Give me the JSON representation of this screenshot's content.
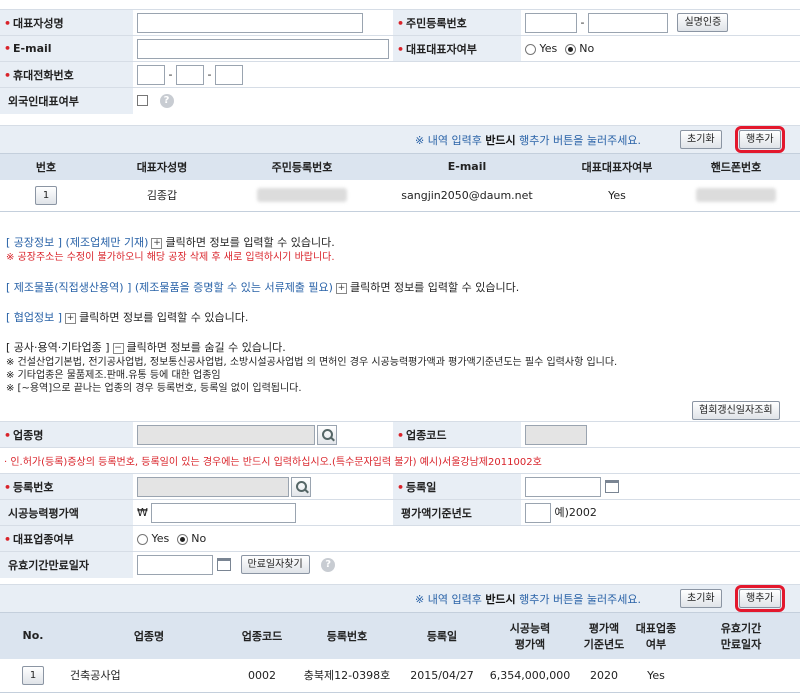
{
  "rep": {
    "name_label": "대표자성명",
    "rrn_label": "주민등록번호",
    "verify_btn": "실명인증",
    "email_label": "E-mail",
    "is_rep_label": "대표대표자여부",
    "yes": "Yes",
    "no": "No",
    "phone_label": "휴대전화번호",
    "foreign_label": "외국인대표여부",
    "notice_pre": "※ 내역 입력후 ",
    "notice_bold": "반드시",
    "notice_post": " 행추가 버튼을 눌러주세요.",
    "reset_btn": "초기화",
    "add_btn": "행추가",
    "dash": "-"
  },
  "rep_table": {
    "headers": [
      "번호",
      "대표자성명",
      "주민등록번호",
      "E-mail",
      "대표대표자여부",
      "핸드폰번호"
    ],
    "row": {
      "num": "1",
      "name": "김종갑",
      "email": "sangjin2050@daum.net",
      "is_rep": "Yes"
    }
  },
  "sections": {
    "factory_title": "[ 공장정보 ] (제조업체만 기재)",
    "factory_hint": "클릭하면 정보를 입력할 수 있습니다.",
    "factory_warn": "※ 공장주소는 수정이 불가하오니 해당 공장 삭제 후 새로 입력하시기 바랍니다.",
    "product_title": "[ 제조물품(직접생산용역) ] (제조물품을 증명할 수 있는 서류제출 필요)",
    "product_hint": "클릭하면 정보를 입력할 수 있습니다.",
    "coop_title": "[ 협업정보 ]",
    "coop_hint": "클릭하면 정보를 입력할 수 있습니다.",
    "biz_title": "[ 공사·용역·기타업종 ]",
    "biz_hint": "클릭하면 정보를 숨길 수 있습니다.",
    "note1": "※ 건설산업기본법, 전기공사업법, 정보통신공사업법, 소방시설공사업법 의 면허인 경우 시공능력평가액과 평가액기준년도는 필수 입력사항 입니다.",
    "note2": "※ 기타업종은 물품제조.판매.유통 등에 대한 업종임",
    "note3": "※ [~용역]으로 끝나는 업종의 경우 등록번호, 등록일 없이 입력됩니다.",
    "assoc_btn": "협회갱신일자조회"
  },
  "biz": {
    "type_label": "업종명",
    "code_label": "업종코드",
    "warn": "· 인.허가(등록)증상의 등록번호, 등록일이 있는 경우에는 반드시 입력하십시오.(특수문자입력 불가) 예시)서울강남제2011002호",
    "reg_label": "등록번호",
    "regdate_label": "등록일",
    "capacity_label": "시공능력평가액",
    "won": "₩",
    "year_label": "평가액기준년도",
    "year_example": "예)2002",
    "main_label": "대표업종여부",
    "expire_label": "유효기간만료일자",
    "expire_btn": "만료일자찾기"
  },
  "biz_table": {
    "headers": [
      "No.",
      "업종명",
      "업종코드",
      "등록번호",
      "등록일",
      "시공능력\n평가액",
      "평가액\n기준년도",
      "대표업종\n여부",
      "유효기간\n만료일자"
    ],
    "row": {
      "num": "1",
      "type": "건축공사업",
      "code": "0002",
      "reg": "충북제12-0398호",
      "date": "2015/04/27",
      "amount": "6,354,000,000",
      "year": "2020",
      "main": "Yes",
      "expire": ""
    }
  }
}
